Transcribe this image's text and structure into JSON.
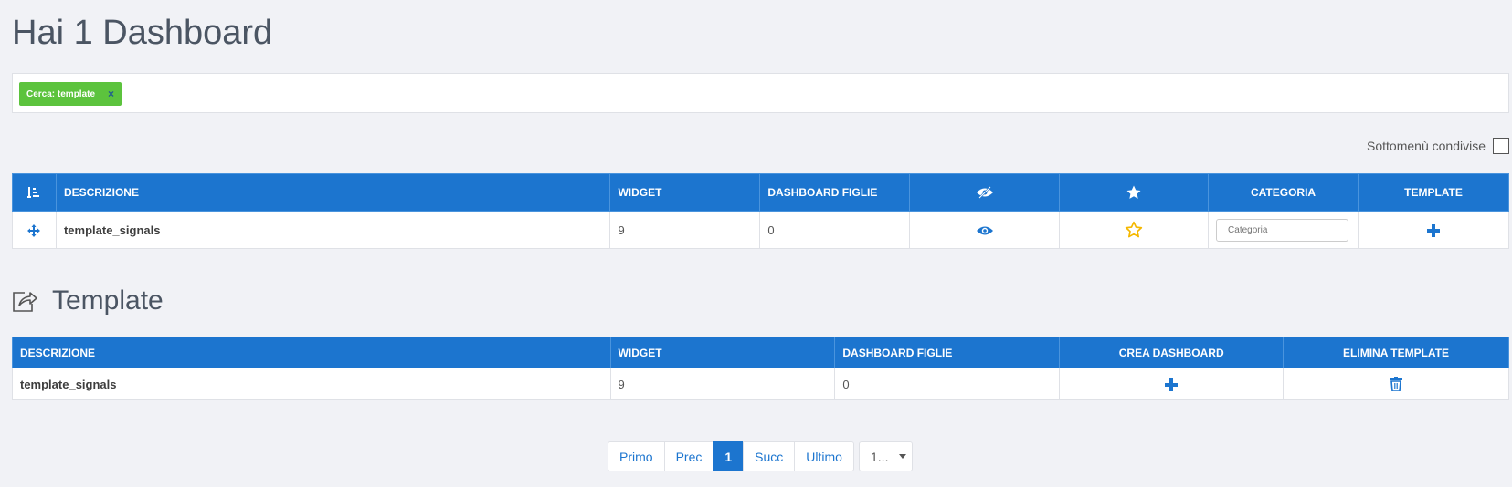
{
  "page": {
    "title": "Hai 1 Dashboard"
  },
  "filter": {
    "tag_label": "Cerca: template",
    "remove_symbol": "×"
  },
  "shared_submenus": {
    "label": "Sottomenù condivise",
    "checked": false
  },
  "dashboards": {
    "headers": {
      "description": "DESCRIZIONE",
      "widget": "WIDGET",
      "child_dashboards": "DASHBOARD FIGLIE",
      "category": "CATEGORIA",
      "template": "TEMPLATE"
    },
    "rows": [
      {
        "description": "template_signals",
        "widget": "9",
        "child_dashboards": "0",
        "category_placeholder": "Categoria"
      }
    ]
  },
  "templates": {
    "section_title": "Template",
    "headers": {
      "description": "DESCRIZIONE",
      "widget": "WIDGET",
      "child_dashboards": "DASHBOARD FIGLIE",
      "create_dashboard": "CREA DASHBOARD",
      "delete_template": "ELIMINA TEMPLATE"
    },
    "rows": [
      {
        "description": "template_signals",
        "widget": "9",
        "child_dashboards": "0"
      }
    ]
  },
  "pagination": {
    "first": "Primo",
    "prev": "Prec",
    "current": "1",
    "next": "Succ",
    "last": "Ultimo",
    "page_size": "1..."
  },
  "icons": {
    "sort": "sort-icon",
    "move": "move-arrows-icon",
    "visibility": "eye-icon",
    "favorite": "star-icon",
    "add": "plus-icon",
    "delete": "trash-icon",
    "share": "share-icon"
  },
  "colors": {
    "accent": "#1c75cf",
    "tag": "#5cc33d",
    "star": "#f5b800"
  }
}
